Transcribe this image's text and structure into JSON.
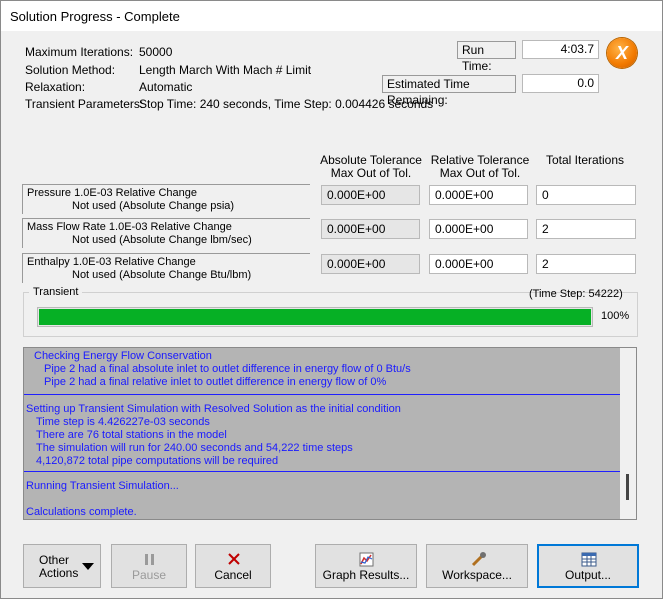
{
  "window": {
    "title": "Solution Progress - Complete"
  },
  "info": [
    {
      "label": "Maximum Iterations:",
      "value": "50000"
    },
    {
      "label": "Solution Method:",
      "value": "Length March With Mach # Limit"
    },
    {
      "label": "Relaxation:",
      "value": "Automatic"
    },
    {
      "label": "Transient Parameters:",
      "value": "Stop Time: 240 seconds, Time Step: 0.004426 seconds"
    }
  ],
  "run_time": {
    "label": "Run Time:",
    "value": "4:03.7"
  },
  "est_time": {
    "label": "Estimated Time Remaining:",
    "value": "0.0"
  },
  "close_icon_letter": "X",
  "columns": {
    "abs_line1": "Absolute Tolerance",
    "abs_line2": "Max Out of Tol.",
    "rel_line1": "Relative Tolerance",
    "rel_line2": "Max Out of Tol.",
    "iter": "Total Iterations"
  },
  "rows": [
    {
      "l1": "Pressure 1.0E-03 Relative Change",
      "l2": "Not used (Absolute Change psia)",
      "abs": "0.000E+00",
      "rel": "0.000E+00",
      "iter": "0"
    },
    {
      "l1": "Mass Flow Rate 1.0E-03 Relative Change",
      "l2": "Not used (Absolute Change lbm/sec)",
      "abs": "0.000E+00",
      "rel": "0.000E+00",
      "iter": "2"
    },
    {
      "l1": "Enthalpy 1.0E-03 Relative Change",
      "l2": "Not used (Absolute Change Btu/lbm)",
      "abs": "0.000E+00",
      "rel": "0.000E+00",
      "iter": "2"
    }
  ],
  "transient": {
    "label": "Transient",
    "time_step": "(Time Step: 54222)",
    "percent_text": "100%",
    "progress": 1.0,
    "color": "#06b025"
  },
  "log": {
    "lines": [
      "Checking Energy Flow Conservation",
      "Pipe 2 had a final absolute inlet to outlet difference in energy flow of 0 Btu/s",
      "Pipe 2 had a final relative inlet to outlet difference in energy flow of 0%",
      "Setting up Transient Simulation with Resolved Solution as the initial condition",
      "Time step is 4.426227e-03 seconds",
      "There are 76 total stations in the model",
      "The simulation will run for 240.00 seconds and 54,222 time steps",
      "4,120,872 total pipe computations will be required",
      "Running Transient Simulation...",
      "Calculations complete."
    ]
  },
  "buttons": {
    "other_actions_line1": "Other",
    "other_actions_line2": "Actions",
    "pause": "Pause",
    "cancel": "Cancel",
    "graph": "Graph Results...",
    "workspace": "Workspace...",
    "output": "Output..."
  }
}
